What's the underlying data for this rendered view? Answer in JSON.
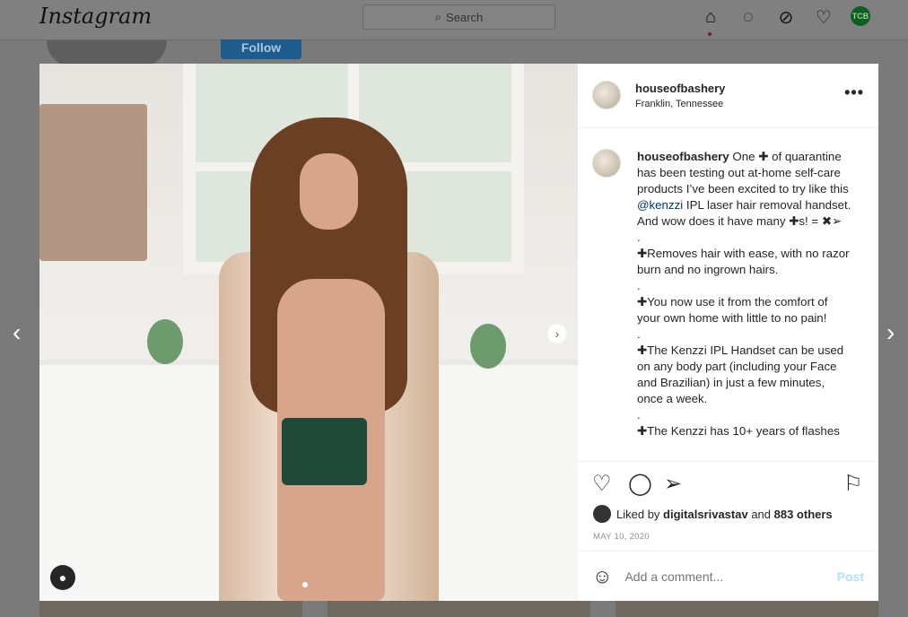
{
  "nav": {
    "logo": "Instagram",
    "search_placeholder": "Search",
    "avatar_initials": "TCB",
    "icons": [
      "home-icon",
      "messenger-icon",
      "explore-icon",
      "heart-icon"
    ]
  },
  "background": {
    "follow_label": "Follow"
  },
  "post": {
    "username": "houseofbashery",
    "location": "Franklin, Tennessee",
    "caption": {
      "line1_prefix": "One ✚ of quarantine has been testing out at-home self-care products I’ve been excited to try like this ",
      "mention": "@kenzzi",
      "line1_suffix": " IPL laser hair removal handset. And wow does it have many ✚s! = ✖➢",
      "dot": ".",
      "bullets": [
        "✚Removes hair with ease, with no razor burn and no ingrown hairs.",
        "✚You now use it from the comfort of your own home with little to no pain!",
        "✚The Kenzzi IPL Handset can be used on any body part (including your Face and Brazilian) in just a few minutes, once a week.",
        "✚The Kenzzi has 10+ years of flashes"
      ]
    },
    "liked_by_prefix": "Liked by ",
    "liked_by_user": "digitalsrivastav",
    "liked_by_suffix": " and ",
    "liked_by_others": "883 others",
    "date": "MAY 10, 2020",
    "comment_placeholder": "Add a comment...",
    "post_label": "Post",
    "carousel_position": 1
  }
}
